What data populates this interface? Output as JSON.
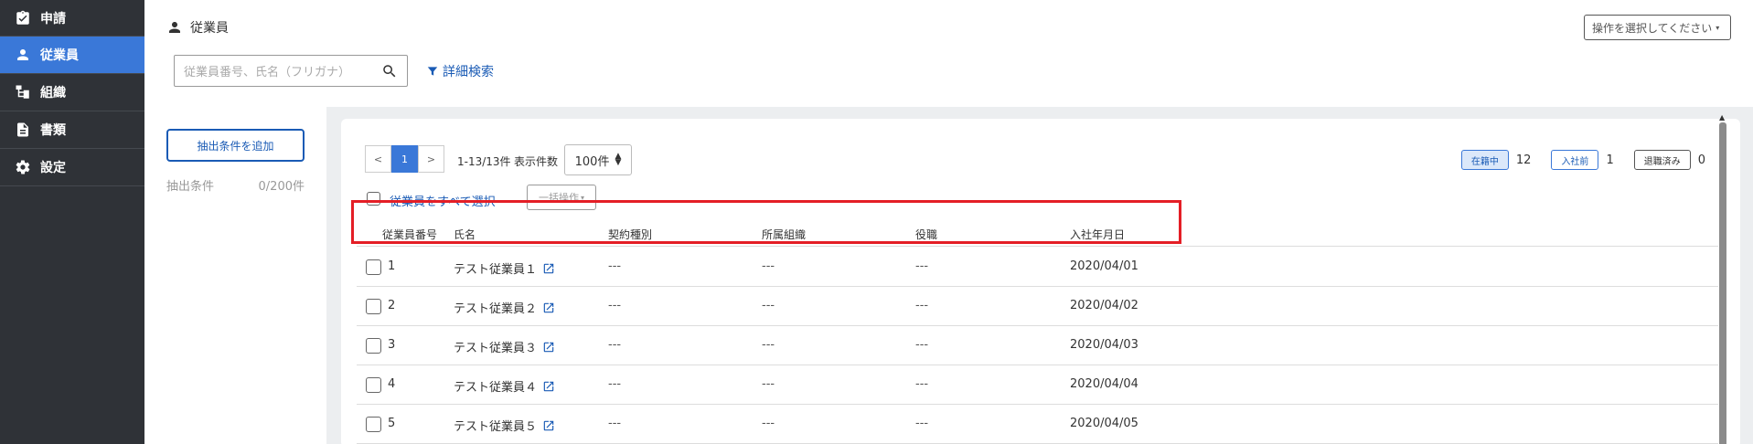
{
  "sidebar": {
    "items": [
      {
        "label": "申請",
        "icon": "clipboard-check-icon"
      },
      {
        "label": "従業員",
        "icon": "person-icon",
        "active": true
      },
      {
        "label": "組織",
        "icon": "org-chart-icon"
      },
      {
        "label": "書類",
        "icon": "document-icon"
      },
      {
        "label": "設定",
        "icon": "gear-icon"
      }
    ]
  },
  "header": {
    "title": "従業員",
    "operation_select": "操作を選択してください",
    "search_placeholder": "従業員番号、氏名（フリガナ）",
    "advanced_search": "詳細検索"
  },
  "filter": {
    "add_button": "抽出条件を追加",
    "label": "抽出条件",
    "count": "0/200件"
  },
  "pagination": {
    "prev": "<",
    "current": "1",
    "next": ">",
    "range": "1-13/13件",
    "per_page_label": "表示件数",
    "per_page_value": "100件"
  },
  "status": {
    "active_label": "在籍中",
    "active_count": "12",
    "pre_label": "入社前",
    "pre_count": "1",
    "retired_label": "退職済み",
    "retired_count": "0"
  },
  "bulk": {
    "select_all": "従業員をすべて選択",
    "bulk_action": "一括操作"
  },
  "table": {
    "columns": [
      "従業員番号",
      "氏名",
      "契約種別",
      "所属組織",
      "役職",
      "入社年月日"
    ],
    "rows": [
      {
        "id": "1",
        "name": "テスト従業員１",
        "contract": "---",
        "org": "---",
        "position": "---",
        "joined": "2020/04/01"
      },
      {
        "id": "2",
        "name": "テスト従業員２",
        "contract": "---",
        "org": "---",
        "position": "---",
        "joined": "2020/04/02"
      },
      {
        "id": "3",
        "name": "テスト従業員３",
        "contract": "---",
        "org": "---",
        "position": "---",
        "joined": "2020/04/03"
      },
      {
        "id": "4",
        "name": "テスト従業員４",
        "contract": "---",
        "org": "---",
        "position": "---",
        "joined": "2020/04/04"
      },
      {
        "id": "5",
        "name": "テスト従業員５",
        "contract": "---",
        "org": "---",
        "position": "---",
        "joined": "2020/04/05"
      }
    ]
  },
  "colors": {
    "sidebar_bg": "#2f3237",
    "accent": "#3a78d8",
    "link": "#1a5bb5",
    "highlight": "#e41e26"
  }
}
